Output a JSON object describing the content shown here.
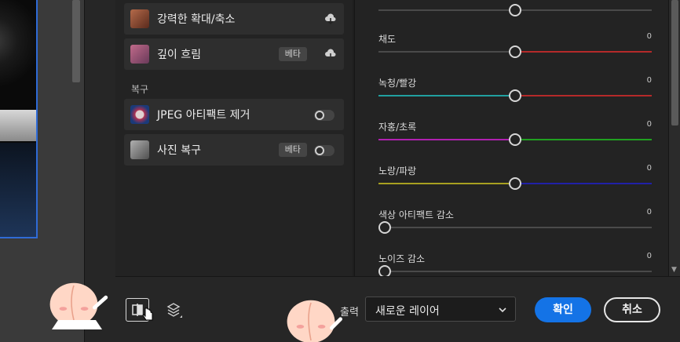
{
  "filters": {
    "items_top": [
      {
        "label": "강력한 확대/축소",
        "badge": "",
        "thumb": "portrait-face",
        "action": "cloud-download-icon"
      },
      {
        "label": "깊이 흐림",
        "badge": "베타",
        "thumb": "portrait-girl",
        "action": "cloud-download-icon"
      }
    ],
    "section_restore": "복구",
    "items_restore": [
      {
        "label": "JPEG 아티팩트 제거",
        "badge": "",
        "thumb": "artifact",
        "action": "toggle"
      },
      {
        "label": "사진 복구",
        "badge": "베타",
        "thumb": "old-photo",
        "action": "toggle"
      }
    ]
  },
  "sliders": [
    {
      "label": "",
      "value": "",
      "position": 0.5,
      "track": "neutral"
    },
    {
      "label": "채도",
      "value": "0",
      "position": 0.5,
      "track": "saturation"
    },
    {
      "label": "녹청/빨강",
      "value": "0",
      "position": 0.5,
      "track": "cyan-red"
    },
    {
      "label": "자홍/초록",
      "value": "0",
      "position": 0.5,
      "track": "magenta-green"
    },
    {
      "label": "노랑/파랑",
      "value": "0",
      "position": 0.5,
      "track": "yellow-blue"
    },
    {
      "label": "색상 아티팩트 감소",
      "value": "0",
      "position": 0.0,
      "track": "neutral"
    },
    {
      "label": "노이즈 감소",
      "value": "0",
      "position": 0.0,
      "track": "neutral"
    }
  ],
  "bottom": {
    "output_label": "출력",
    "output_value": "새로운 레이어",
    "ok_label": "확인",
    "cancel_label": "취소"
  },
  "colors": {
    "accent": "#1473e6",
    "selection_border": "#2f6bd6"
  }
}
